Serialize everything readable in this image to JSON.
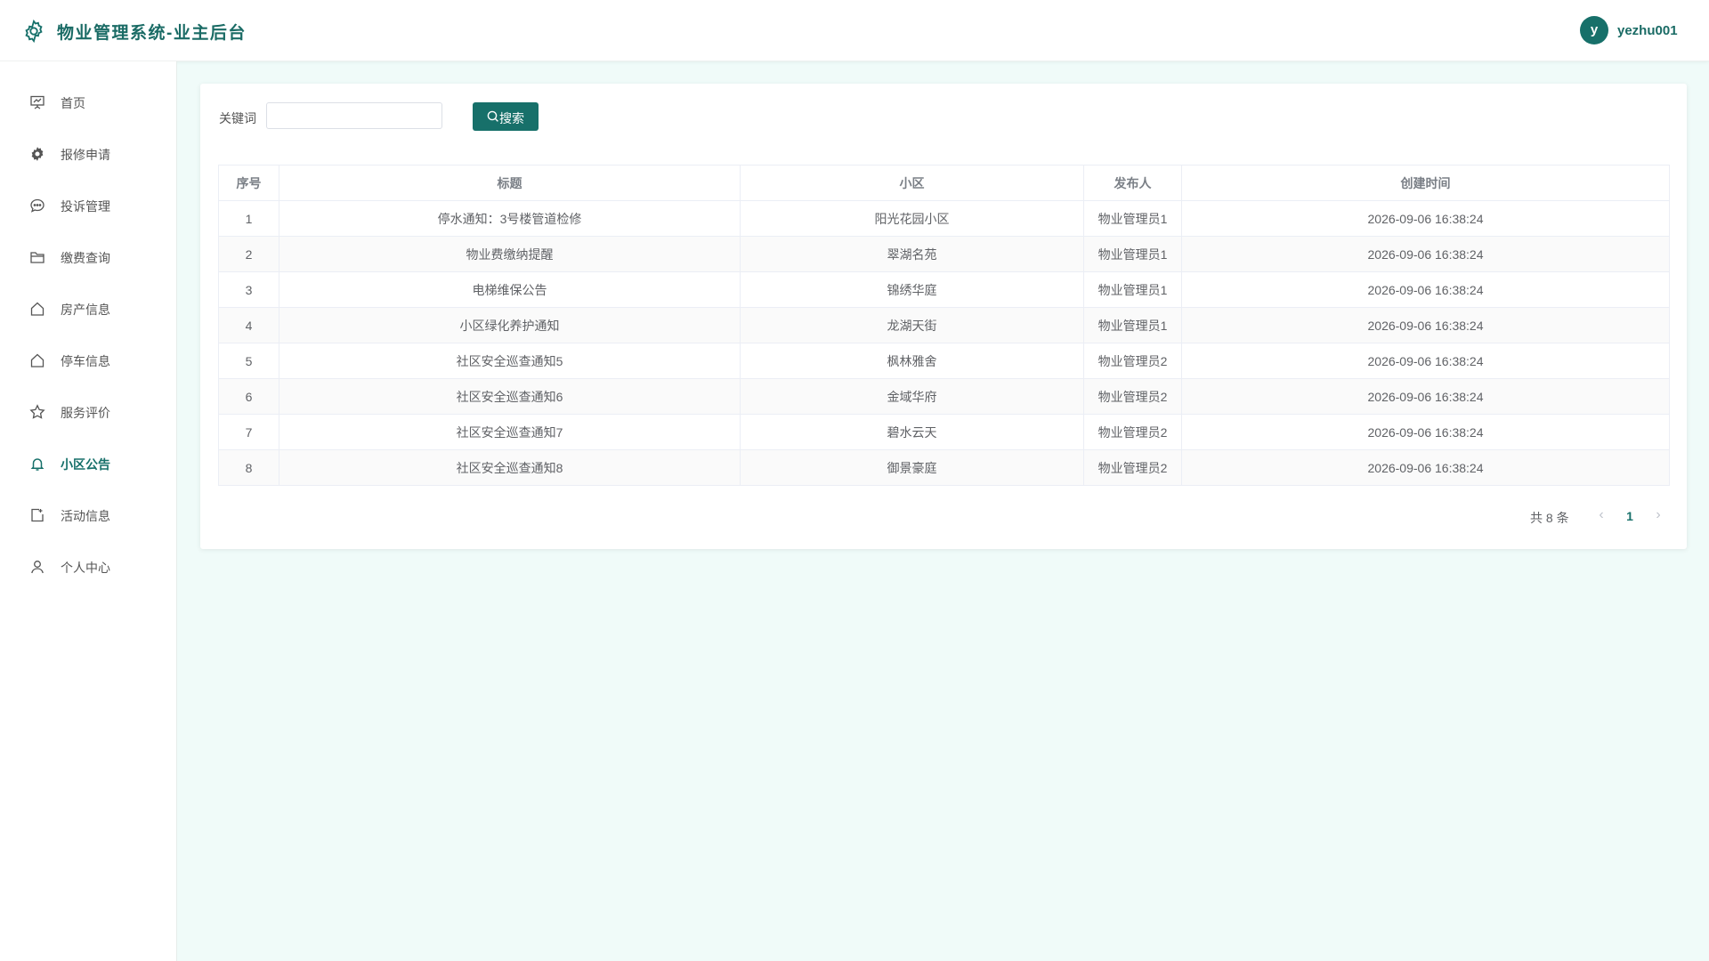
{
  "header": {
    "title": "物业管理系统-业主后台",
    "logo_icon": "gear-icon",
    "avatar_letter": "y",
    "username": "yezhu001",
    "accent_color": "#17706a"
  },
  "sidebar": {
    "items": [
      {
        "label": "首页",
        "icon": "presentation-board-icon",
        "active": false
      },
      {
        "label": "报修申请",
        "icon": "gear-icon",
        "active": false
      },
      {
        "label": "投诉管理",
        "icon": "chat-bubble-icon",
        "active": false
      },
      {
        "label": "缴费查询",
        "icon": "folder-icon",
        "active": false
      },
      {
        "label": "房产信息",
        "icon": "house-icon",
        "active": false
      },
      {
        "label": "停车信息",
        "icon": "house-icon",
        "active": false
      },
      {
        "label": "服务评价",
        "icon": "star-icon",
        "active": false
      },
      {
        "label": "小区公告",
        "icon": "bell-icon",
        "active": true
      },
      {
        "label": "活动信息",
        "icon": "event-icon",
        "active": false
      },
      {
        "label": "个人中心",
        "icon": "user-icon",
        "active": false
      }
    ]
  },
  "search": {
    "label": "关键词",
    "value": "",
    "placeholder": "",
    "button_label": "搜索",
    "button_icon": "search-icon"
  },
  "table": {
    "columns": [
      "序号",
      "标题",
      "小区",
      "发布人",
      "创建时间"
    ],
    "rows": [
      [
        "1",
        "停水通知：3号楼管道检修",
        "阳光花园小区",
        "物业管理员1",
        "2026-09-06 16:38:24"
      ],
      [
        "2",
        "物业费缴纳提醒",
        "翠湖名苑",
        "物业管理员1",
        "2026-09-06 16:38:24"
      ],
      [
        "3",
        "电梯维保公告",
        "锦绣华庭",
        "物业管理员1",
        "2026-09-06 16:38:24"
      ],
      [
        "4",
        "小区绿化养护通知",
        "龙湖天街",
        "物业管理员1",
        "2026-09-06 16:38:24"
      ],
      [
        "5",
        "社区安全巡查通知5",
        "枫林雅舍",
        "物业管理员2",
        "2026-09-06 16:38:24"
      ],
      [
        "6",
        "社区安全巡查通知6",
        "金域华府",
        "物业管理员2",
        "2026-09-06 16:38:24"
      ],
      [
        "7",
        "社区安全巡查通知7",
        "碧水云天",
        "物业管理员2",
        "2026-09-06 16:38:24"
      ],
      [
        "8",
        "社区安全巡查通知8",
        "御景豪庭",
        "物业管理员2",
        "2026-09-06 16:38:24"
      ]
    ]
  },
  "pagination": {
    "total_text": "共 8 条",
    "current_page": "1",
    "prev_icon": "chevron-left-icon",
    "next_icon": "chevron-right-icon"
  }
}
